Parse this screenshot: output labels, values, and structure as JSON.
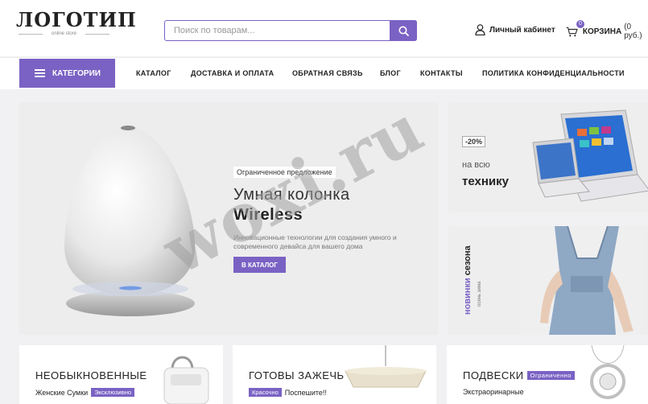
{
  "header": {
    "logo_text": "ЛОГОТИП",
    "logo_sub": "online store",
    "search_placeholder": "Поиск по товарам...",
    "account_label": "Личный кабинет",
    "cart_label": "КОРЗИНА",
    "cart_sum": "(0 руб.)",
    "cart_count": "0"
  },
  "nav": {
    "categories_label": "КАТЕГОРИИ",
    "links": [
      "КАТАЛОГ",
      "ДОСТАВКА И ОПЛАТА",
      "ОБРАТНАЯ СВЯЗЬ",
      "БЛОГ",
      "КОНТАКТЫ",
      "ПОЛИТИКА КОНФИДЕНЦИАЛЬНОСТИ"
    ]
  },
  "hero": {
    "badge": "Ограниченное предложение",
    "title_line1": "Умная колонка",
    "title_line2": "Wireless",
    "description": "Инновационные технологии для создания умного и современного девайса для вашего дома",
    "button_label": "В КАТАЛОГ"
  },
  "banner_tech": {
    "discount": "-20%",
    "small": "на всю",
    "big": "технику"
  },
  "banner_season": {
    "title_accent": "новинки",
    "title_rest": " сезона",
    "subtitle": "осень зима"
  },
  "cards": [
    {
      "title": "НЕОБЫКНОВЕННЫЕ",
      "sub": "Женские Сумки",
      "tag": "Эксклюзивно",
      "tag_first": false
    },
    {
      "title": "ГОТОВЫ ЗАЖЕЧЬ",
      "sub": "Поспешите!!",
      "tag": "Красочно",
      "tag_first": true
    },
    {
      "title": "ПОДВЕСКИ",
      "sub": "Экстраоринарные",
      "tag": "Ограниченно",
      "tag_first": false
    }
  ],
  "watermark": "woxi.ru",
  "colors": {
    "accent": "#7a62c4",
    "background": "#f1f1f3"
  }
}
